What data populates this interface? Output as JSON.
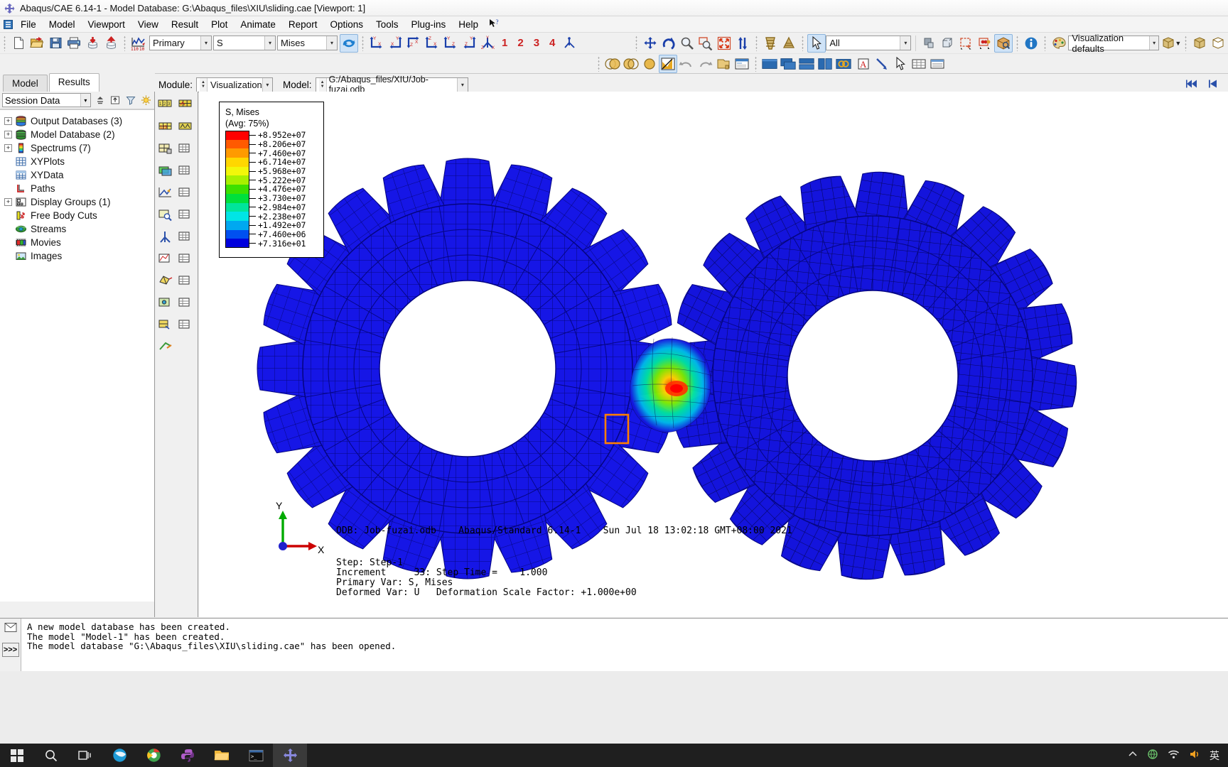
{
  "window": {
    "title": "Abaqus/CAE 6.14-1 - Model Database: G:\\Abaqus_files\\XIU\\sliding.cae [Viewport: 1]",
    "app_icon": "abaqus-icon"
  },
  "menubar": {
    "items": [
      "File",
      "Model",
      "Viewport",
      "View",
      "Result",
      "Plot",
      "Animate",
      "Report",
      "Options",
      "Tools",
      "Plug-ins",
      "Help"
    ],
    "help_pointer": "contextual-help-icon"
  },
  "toolbar": {
    "file_buttons": [
      "new-icon",
      "open-icon",
      "save-icon",
      "print-icon",
      "import-icon",
      "export-icon"
    ],
    "field_output": {
      "plot_state_icon": "field-output-icon",
      "primary": "Primary",
      "variable": "S",
      "component": "Mises",
      "refresh_icon": "refresh-icon"
    },
    "view_buttons": [
      "view-xy-icon",
      "view-yx-icon",
      "view-xz-icon",
      "view-zx-icon",
      "view-yz-icon",
      "view-zy-icon",
      "view-iso-icon"
    ],
    "view_numbers": [
      "1",
      "2",
      "3",
      "4"
    ],
    "view_apply_icon": "apply-view-icon",
    "manipulate": [
      "pan-icon",
      "rotate-icon",
      "zoom-icon",
      "box-zoom-icon",
      "fit-view-icon",
      "cycle-view-icon"
    ],
    "render": [
      "render-wireframe-icon",
      "render-filled-icon"
    ],
    "selection": {
      "pointer_icon": "select-pointer-icon",
      "filter": "All"
    },
    "display_buttons": [
      "node-select-icon",
      "element-select-icon",
      "create-display-group-icon",
      "replace-display-group-icon",
      "color-code-icon"
    ],
    "info_icon": "info-icon",
    "color_palette_icon": "color-palette-icon",
    "defaults": "Visualization defaults",
    "view_cube_icon": "view-cube-icon",
    "view_cube_dropdown_icon": "chevron-down-icon",
    "viewport_cubes": [
      "viewport-cube-1-icon",
      "viewport-cube-2-icon"
    ],
    "row2": {
      "contour_buttons": [
        "contour-overlay-icon",
        "contour-symbol-icon",
        "contour-fill-icon",
        "contour-limit-icon"
      ],
      "undo_icon": "undo-icon",
      "redo_icon": "redo-icon",
      "odb_icon": "odb-display-icon",
      "report_icon": "report-icon",
      "window_buttons": [
        "window-single-icon",
        "window-cascade-icon",
        "window-tile-horizontal-icon",
        "window-tile-vertical-icon",
        "window-link-icon"
      ],
      "annotate_icon": "annotate-text-icon",
      "arrow_icon": "annotate-arrow-icon",
      "select_icon": "annotate-select-icon",
      "table_icons": [
        "annotate-table-icon",
        "annotate-list-icon"
      ]
    }
  },
  "modulebar": {
    "module_label": "Module:",
    "module_value": "Visualization",
    "model_label": "Model:",
    "model_value": "G:/Abaqus_files/XIU/Job-fuzai.odb",
    "nav_first_icon": "skip-first-icon",
    "nav_prev_icon": "step-back-icon"
  },
  "leftpanel": {
    "tabs": [
      {
        "label": "Model",
        "active": false
      },
      {
        "label": "Results",
        "active": true
      }
    ],
    "session_selector": "Session Data",
    "toolbar_icons": [
      "sort-icon",
      "up-level-icon",
      "filter-icon",
      "bulb-icon"
    ],
    "tree": [
      {
        "label": "Output Databases (3)",
        "expandable": true,
        "icon": "output-database-icon"
      },
      {
        "label": "Model Database (2)",
        "expandable": true,
        "icon": "model-database-icon"
      },
      {
        "label": "Spectrums (7)",
        "expandable": true,
        "icon": "spectrum-icon"
      },
      {
        "label": "XYPlots",
        "expandable": false,
        "icon": "xyplot-icon"
      },
      {
        "label": "XYData",
        "expandable": false,
        "icon": "xydata-icon"
      },
      {
        "label": "Paths",
        "expandable": false,
        "icon": "path-icon"
      },
      {
        "label": "Display Groups (1)",
        "expandable": true,
        "icon": "display-group-icon"
      },
      {
        "label": "Free Body Cuts",
        "expandable": false,
        "icon": "free-body-cut-icon"
      },
      {
        "label": "Streams",
        "expandable": false,
        "icon": "streams-icon"
      },
      {
        "label": "Movies",
        "expandable": false,
        "icon": "movies-icon"
      },
      {
        "label": "Images",
        "expandable": false,
        "icon": "images-icon"
      }
    ]
  },
  "legend": {
    "title": "S, Mises",
    "subtitle": "(Avg: 75%)",
    "values": [
      "+8.952e+07",
      "+8.206e+07",
      "+7.460e+07",
      "+6.714e+07",
      "+5.968e+07",
      "+5.222e+07",
      "+4.476e+07",
      "+3.730e+07",
      "+2.984e+07",
      "+2.238e+07",
      "+1.492e+07",
      "+7.460e+06",
      "+7.316e+01"
    ],
    "colors": [
      "#ff0000",
      "#ff5a00",
      "#ff9a00",
      "#ffd700",
      "#f2f70a",
      "#a8f000",
      "#3de000",
      "#00e03c",
      "#00e59b",
      "#00e5e5",
      "#00a8f0",
      "#0050f0",
      "#0000dd"
    ]
  },
  "viewport": {
    "odb_line": "ODB: Job-fuzai.odb    Abaqus/Standard 6.14-1    Sun Jul 18 13:02:18 GMT+08:00 2021",
    "step_line": "Step: Step-1",
    "increment_line": "Increment     33: Step Time =    1.000",
    "primary_var_line": "Primary Var: S, Mises",
    "deformed_var_line": "Deformed Var: U   Deformation Scale Factor: +1.000e+00",
    "triad": {
      "y_label": "Y",
      "x_label": "X"
    },
    "background": "#ffffff",
    "mesh_color": "#1414e0",
    "highlight_box_color": "#ff7f00"
  },
  "messages": {
    "lines": [
      "A new model database has been created.",
      "The model \"Model-1\" has been created.",
      "The model database \"G:\\Abaqus_files\\XIU\\sliding.cae\" has been opened."
    ],
    "prompt_icon": ">>>",
    "message_icon": "message-area-icon"
  },
  "taskbar": {
    "items": [
      "start-icon",
      "search-icon",
      "task-view-icon",
      "app-browser-icon",
      "app-chrome-icon",
      "app-python-icon",
      "app-explorer-icon",
      "app-terminal-icon",
      "app-abaqus-icon"
    ],
    "tray": [
      "chevron-up-icon",
      "network-icon",
      "wifi-icon",
      "volume-icon",
      "ime-icon"
    ],
    "ime_label": "英"
  }
}
